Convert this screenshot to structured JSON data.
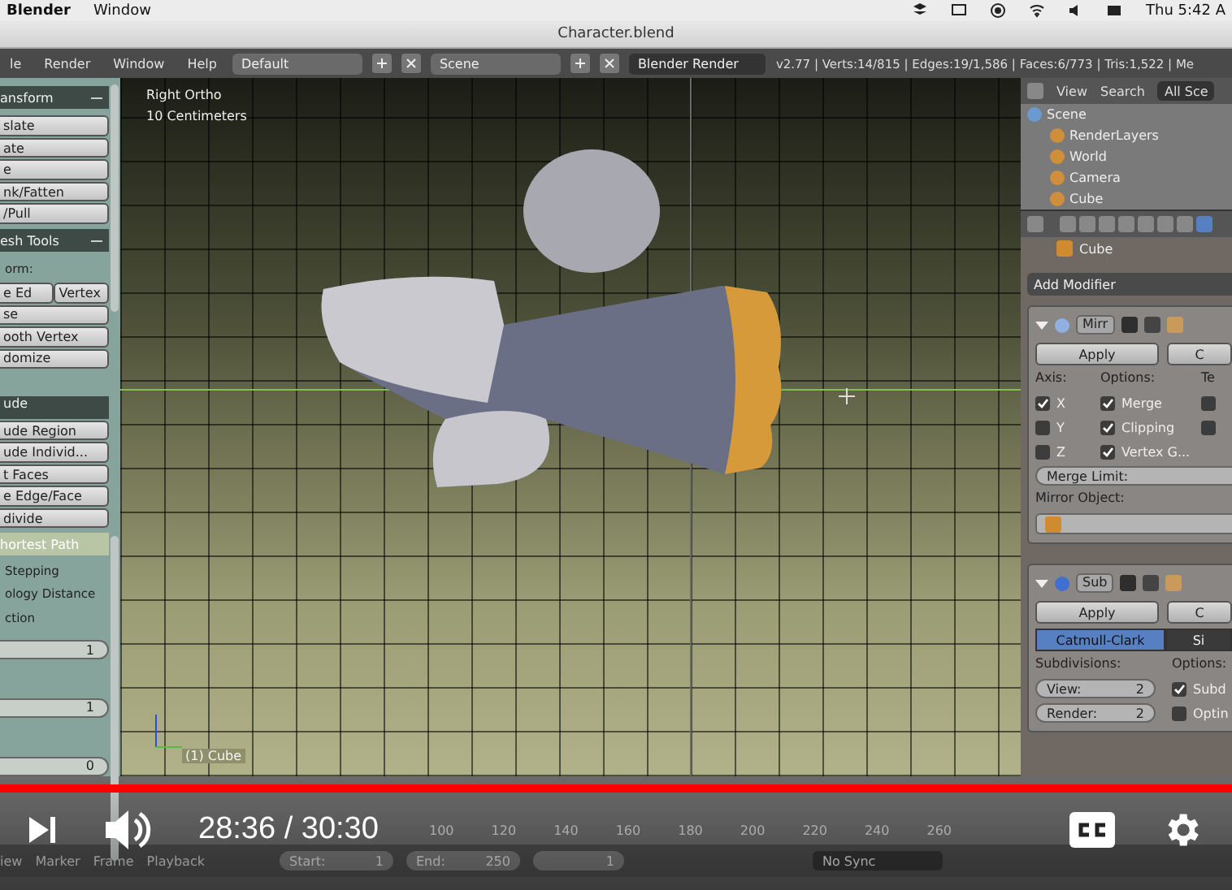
{
  "menubar": {
    "app": "Blender",
    "menus": [
      "Window"
    ],
    "clock": "Thu 5:42 A"
  },
  "title": "Character.blend",
  "info_header": {
    "menus": [
      "le",
      "Render",
      "Window",
      "Help"
    ],
    "layout": "Default",
    "scene": "Scene",
    "engine": "Blender Render",
    "stats": "v2.77 | Verts:14/815 | Edges:19/1,586 | Faces:6/773 | Tris:1,522 | Me"
  },
  "toolshelf": [
    {
      "kind": "header",
      "label": "ansform"
    },
    {
      "kind": "button",
      "label": "slate"
    },
    {
      "kind": "button",
      "label": "ate"
    },
    {
      "kind": "button",
      "label": "e"
    },
    {
      "kind": "button",
      "label": "nk/Fatten"
    },
    {
      "kind": "button",
      "label": "/Pull"
    },
    {
      "kind": "header",
      "label": "esh Tools"
    },
    {
      "kind": "label",
      "label": "orm:"
    },
    {
      "kind": "pair",
      "label": "e Ed",
      "second": "Vertex"
    },
    {
      "kind": "button",
      "label": "se"
    },
    {
      "kind": "button",
      "label": "ooth Vertex"
    },
    {
      "kind": "button",
      "label": "domize"
    },
    {
      "kind": "gap"
    },
    {
      "kind": "dropdown",
      "label": "ude"
    },
    {
      "kind": "button",
      "label": "ude Region"
    },
    {
      "kind": "button",
      "label": "ude Individ..."
    },
    {
      "kind": "button",
      "label": "t Faces"
    },
    {
      "kind": "button",
      "label": "e Edge/Face"
    },
    {
      "kind": "button",
      "label": "divide"
    },
    {
      "kind": "subheader",
      "label": "hortest Path"
    },
    {
      "kind": "label",
      "label": "Stepping"
    },
    {
      "kind": "label",
      "label": "ology Distance"
    },
    {
      "kind": "label",
      "label": "ction"
    },
    {
      "kind": "field",
      "value": "1"
    },
    {
      "kind": "gap"
    },
    {
      "kind": "field",
      "value": "1"
    },
    {
      "kind": "gap"
    },
    {
      "kind": "field",
      "value": "0"
    }
  ],
  "viewport": {
    "view_name": "Right Ortho",
    "units": "10 Centimeters",
    "object": "(1) Cube"
  },
  "outliner": {
    "menus": [
      "View",
      "Search"
    ],
    "filter": "All Sce",
    "tree": [
      {
        "label": "Scene",
        "children": [
          {
            "label": "RenderLayers"
          },
          {
            "label": "World"
          },
          {
            "label": "Camera"
          },
          {
            "label": "Cube"
          }
        ]
      }
    ]
  },
  "properties": {
    "object": "Cube",
    "add_modifier": "Add Modifier",
    "modifiers": [
      {
        "kind": "mirror",
        "name": "Mirr",
        "apply": "Apply",
        "copy": "C",
        "headings": [
          "Axis:",
          "Options:",
          "Te"
        ],
        "axes": [
          {
            "label": "X",
            "checked": true
          },
          {
            "label": "Y",
            "checked": false
          },
          {
            "label": "Z",
            "checked": false
          }
        ],
        "options": [
          {
            "label": "Merge",
            "checked": true
          },
          {
            "label": "Clipping",
            "checked": true
          },
          {
            "label": "Vertex G...",
            "checked": true
          }
        ],
        "extra": [
          {
            "checked": false
          },
          {
            "checked": false
          }
        ],
        "merge_limit": "Merge Limit:",
        "mirror_object": "Mirror Object:"
      },
      {
        "kind": "subsurf",
        "name": "Sub",
        "apply": "Apply",
        "copy": "C",
        "methods": [
          {
            "label": "Catmull-Clark",
            "selected": true
          },
          {
            "label": "Si",
            "selected": false
          }
        ],
        "subdivisions_label": "Subdivisions:",
        "fields": [
          {
            "label": "View:",
            "value": "2"
          },
          {
            "label": "Render:",
            "value": "2"
          }
        ],
        "options_label": "Options:",
        "options": [
          {
            "label": "Subd",
            "checked": true
          },
          {
            "label": "Optin",
            "checked": false
          }
        ]
      }
    ]
  },
  "timeline": {
    "ticks": [
      "100",
      "120",
      "140",
      "160",
      "180",
      "200",
      "220",
      "240",
      "260"
    ],
    "menus": [
      "iew",
      "Marker",
      "Frame",
      "Playback"
    ],
    "start_label": "Start:",
    "start": "1",
    "end_label": "End:",
    "end": "250",
    "current": "1",
    "sync": "No Sync"
  },
  "player": {
    "progress": {
      "level": 1
    },
    "time": "28:36 / 30:30"
  }
}
